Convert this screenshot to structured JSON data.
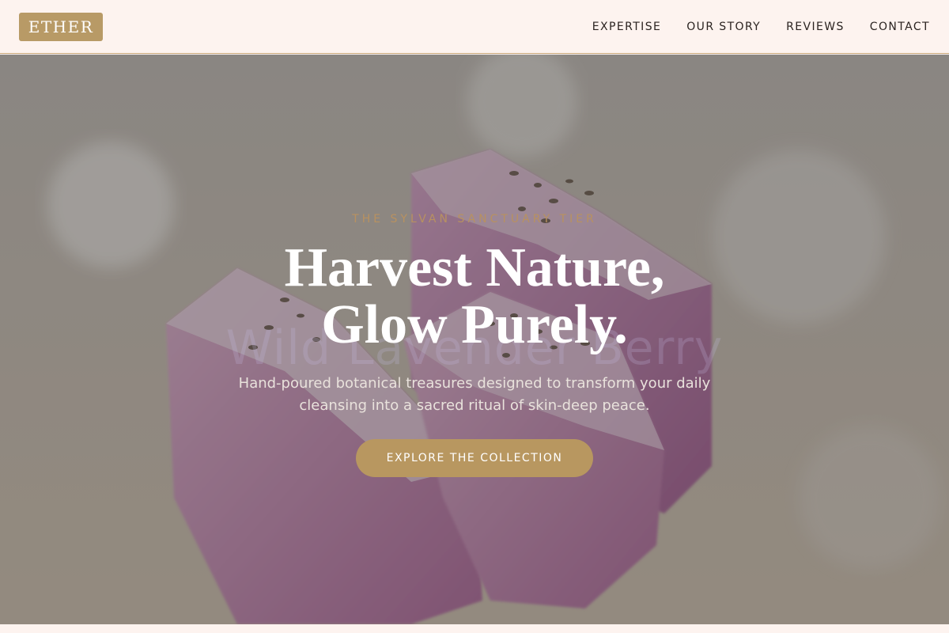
{
  "brand": {
    "logo_text": "ETHER"
  },
  "nav": {
    "items": [
      {
        "label": "EXPERTISE"
      },
      {
        "label": "OUR STORY"
      },
      {
        "label": "REVIEWS"
      },
      {
        "label": "CONTACT"
      }
    ]
  },
  "hero": {
    "eyebrow": "THE SYLVAN SANCTUARY TIER",
    "ghost_text": "Wild Lavender Berry",
    "headline_line1": "Harvest Nature,",
    "headline_line2": "Glow Purely.",
    "subtext": "Hand-poured botanical treasures designed to transform your daily cleansing into a sacred ritual of skin-deep peace.",
    "cta_label": "EXPLORE THE COLLECTION"
  },
  "colors": {
    "accent_gold": "#b89760",
    "nav_background": "#fdf3ef",
    "soap_pink": "#c98fb8"
  }
}
